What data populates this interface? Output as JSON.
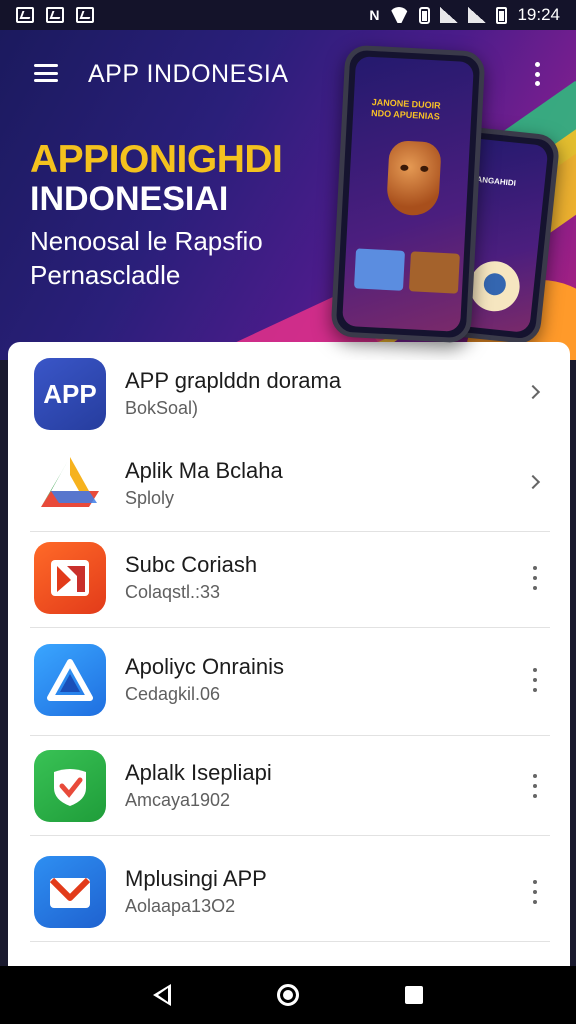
{
  "status_bar": {
    "time": "19:24",
    "left_icons": [
      "image-notification-icon",
      "chart-notification-icon",
      "tv-notification-icon"
    ],
    "right_icons": [
      "nfc-icon",
      "wifi-icon",
      "alert-icon",
      "signal-icon",
      "signal-icon",
      "battery-icon"
    ]
  },
  "app_bar": {
    "title": "APP INDONESIA",
    "menu_icon": "menu-icon",
    "more_icon": "more-vert-icon"
  },
  "hero": {
    "headline": "APPIONIGHDI",
    "subheadline": "INDONESIAI",
    "line1": "Nenoosal le Rapsfio",
    "line2": "Pernascladle",
    "phone_text": "JANONE DUOIR NDO APUENIAS",
    "phone_text_back": "HANGAHIDI"
  },
  "list": {
    "items": [
      {
        "title": "APP graplddn dorama",
        "subtitle": "BokSoal)",
        "icon": "app-icon",
        "icon_label": "APP",
        "action": "chevron-right-icon"
      },
      {
        "title": "Aplik Ma Bclaha",
        "subtitle": "Sploly",
        "icon": "drive-icon",
        "action": "chevron-right-icon"
      },
      {
        "title": "Subc Coriash",
        "subtitle": "Colaqstl.:33",
        "icon": "media-icon",
        "action": "more-vert-icon"
      },
      {
        "title": "Apoliyc Onrainis",
        "subtitle": "Cedagkil.06",
        "icon": "triangle-app-icon",
        "action": "more-vert-icon"
      },
      {
        "title": "Aplalk Isepliapi",
        "subtitle": "Amcaya1902",
        "icon": "shield-check-icon",
        "action": "more-vert-icon"
      },
      {
        "title": "Mplusingi APP",
        "subtitle": "Aolaapa13O2",
        "icon": "gmail-like-icon",
        "action": "more-vert-icon"
      }
    ]
  },
  "nav_bar": {
    "icons": [
      "back-icon",
      "home-icon",
      "recent-apps-icon"
    ]
  },
  "colors": {
    "hero_headline": "#f4c21e",
    "hero_bg_start": "#1b1a5e",
    "hero_bg_end": "#b0207e",
    "card_bg": "#ffffff",
    "nav_bg": "#000000"
  }
}
